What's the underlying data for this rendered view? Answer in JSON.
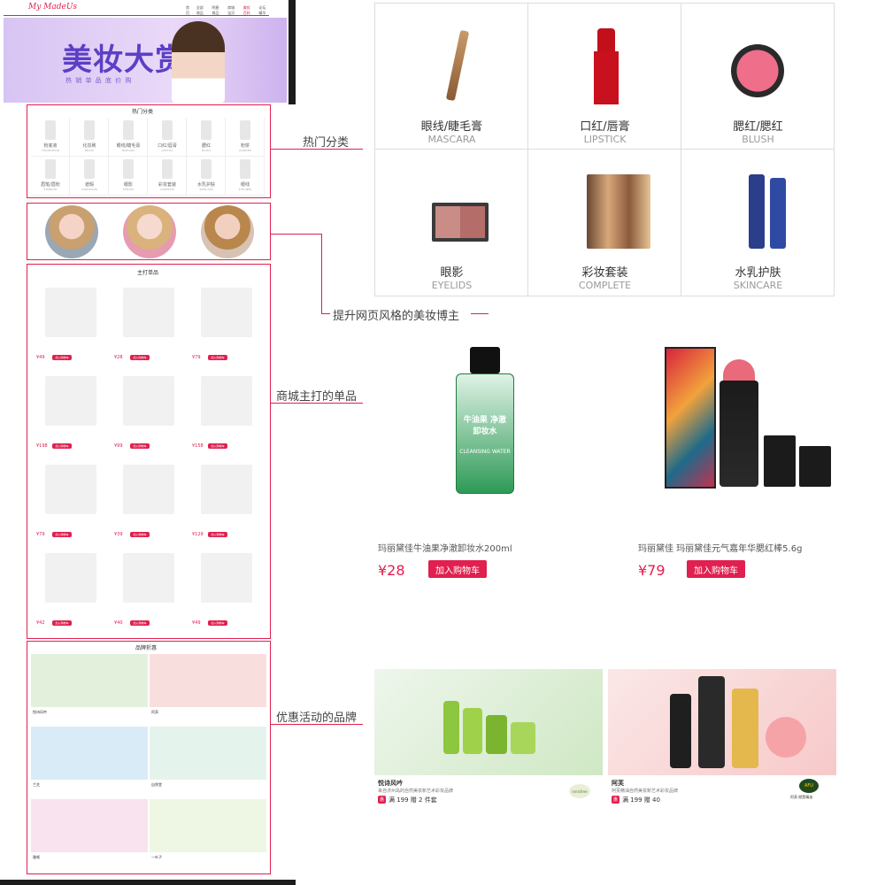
{
  "header": {
    "logo": "My MadeUs",
    "nav": [
      "首页",
      "全部商品",
      "明星商品",
      "商城宝贝",
      "美妆百科",
      "论坛精华"
    ]
  },
  "banner": {
    "title": "美妆大赏",
    "subtitle": "热 销 单 品 底 价 购"
  },
  "hot_categories_preview": {
    "title": "热门分类",
    "items": [
      {
        "cn": "粉底液",
        "en": "FOUNDATION"
      },
      {
        "cn": "化妆刷",
        "en": "BRUSH"
      },
      {
        "cn": "眼线/睫毛膏",
        "en": "MASCARA"
      },
      {
        "cn": "口红/唇膏",
        "en": "LIPSTICK"
      },
      {
        "cn": "腮红",
        "en": "BLUSH"
      },
      {
        "cn": "粉饼",
        "en": "POWDER"
      },
      {
        "cn": "眉笔/眉粉",
        "en": "EYEBROW"
      },
      {
        "cn": "遮瑕",
        "en": "CONCEALER"
      },
      {
        "cn": "眼影",
        "en": "EYELIDS"
      },
      {
        "cn": "彩妆套装",
        "en": "COMPLETE"
      },
      {
        "cn": "水乳护肤",
        "en": "SKINCARE"
      },
      {
        "cn": "眼线",
        "en": "EYELINER"
      }
    ]
  },
  "featured_preview": {
    "title": "主打单品",
    "add_cart": "加入购物车",
    "prices": [
      "¥49",
      "¥28",
      "¥79",
      "¥198",
      "¥99",
      "¥158",
      "¥79",
      "¥39",
      "¥129",
      "¥42",
      "¥40",
      "¥49"
    ]
  },
  "brands_preview": {
    "title": "品牌折惠",
    "brands": [
      "悦诗风吟",
      "阿芙",
      "兰芝",
      "自然堂",
      "雅顿",
      "一叶子"
    ]
  },
  "callouts": {
    "hot_categories": "热门分类",
    "bloggers": "提升网页风格的美妆博主",
    "featured": "商城主打的单品",
    "brands": "优惠活动的品牌"
  },
  "categories_zoom": [
    {
      "cn": "眼线/睫毛膏",
      "en": "MASCARA"
    },
    {
      "cn": "口红/唇膏",
      "en": "LIPSTICK"
    },
    {
      "cn": "腮红/腮红",
      "en": "BLUSH"
    },
    {
      "cn": "眼影",
      "en": "EYELIDS"
    },
    {
      "cn": "彩妆套装",
      "en": "COMPLETE"
    },
    {
      "cn": "水乳护肤",
      "en": "SKINCARE"
    }
  ],
  "featured_zoom": [
    {
      "name": "玛丽黛佳牛油果净澈卸妆水200ml",
      "price": "¥28",
      "button": "加入购物车",
      "product_label": "牛油果 净澈卸妆水",
      "product_label_en": "CLEANSING WATER"
    },
    {
      "name": "玛丽黛佳 玛丽黛佳元气嘉年华腮红棒5.6g",
      "price": "¥79",
      "button": "加入购物车"
    }
  ],
  "brands_zoom": [
    {
      "name": "悦诗风吟",
      "desc": "来自济州岛的自然美妆新艺术彩妆品牌",
      "promo": "满 199 赠 2 件套",
      "badge": "惠",
      "logo": "innisfree"
    },
    {
      "name": "阿芙",
      "desc": "阿芙精油自然美妆新艺术彩妆品牌",
      "promo": "满 199 赠 40",
      "badge": "惠",
      "logo": "AFU",
      "logo_sub": "阿芙·就是精油"
    }
  ],
  "colors": {
    "accent": "#e0204f",
    "banner_bg": "#d8c6f2"
  }
}
